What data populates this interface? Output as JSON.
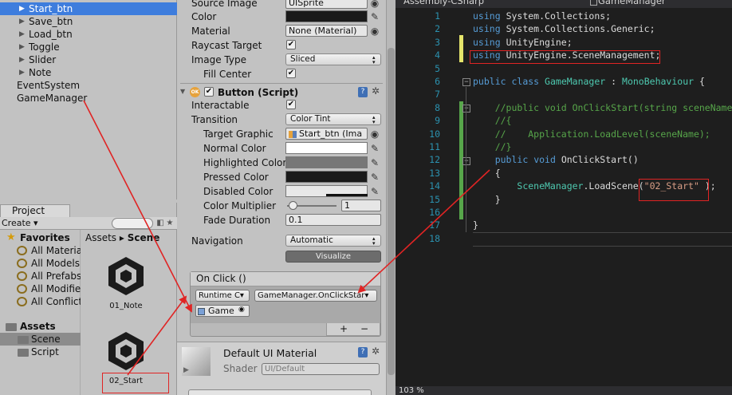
{
  "hierarchy": {
    "items": [
      {
        "label": "Start_btn",
        "depth": 1,
        "expand": "▶",
        "selected": true
      },
      {
        "label": "Save_btn",
        "depth": 1,
        "expand": "▶"
      },
      {
        "label": "Load_btn",
        "depth": 1,
        "expand": "▶"
      },
      {
        "label": "Toggle",
        "depth": 1,
        "expand": "▶"
      },
      {
        "label": "Slider",
        "depth": 1,
        "expand": "▶"
      },
      {
        "label": "Note",
        "depth": 1,
        "expand": "▶"
      },
      {
        "label": "EventSystem",
        "depth": 0
      },
      {
        "label": "GameManager",
        "depth": 0
      }
    ]
  },
  "project": {
    "tab_label": "Project",
    "create_label": "Create ▾",
    "favorites_label": "Favorites",
    "favorites": [
      "All Materia",
      "All Models",
      "All Prefabs",
      "All Modifie",
      "All Conflict"
    ],
    "assets_label": "Assets",
    "folders": [
      "Scene",
      "Script"
    ],
    "breadcrumb_root": "Assets",
    "breadcrumb_sep": "▸",
    "breadcrumb_current": "Scene",
    "scene_assets": [
      "01_Note",
      "02_Start"
    ]
  },
  "inspector": {
    "source_image_label": "Source Image",
    "source_image_value": "UISprite",
    "color_label": "Color",
    "material_label": "Material",
    "material_value": "None (Material)",
    "raycast_label": "Raycast Target",
    "image_type_label": "Image Type",
    "image_type_value": "Sliced",
    "fill_center_label": "Fill Center",
    "button_header": "Button (Script)",
    "interactable_label": "Interactable",
    "transition_label": "Transition",
    "transition_value": "Color Tint",
    "target_graphic_label": "Target Graphic",
    "target_graphic_value": "Start_btn (Ima",
    "normal_color_label": "Normal Color",
    "highlighted_color_label": "Highlighted Color",
    "pressed_color_label": "Pressed Color",
    "disabled_color_label": "Disabled Color",
    "color_multiplier_label": "Color Multiplier",
    "color_multiplier_value": "1",
    "fade_duration_label": "Fade Duration",
    "fade_duration_value": "0.1",
    "navigation_label": "Navigation",
    "navigation_value": "Automatic",
    "visualize_label": "Visualize",
    "onclick_label": "On Click ()",
    "runtime_value": "Runtime C▾",
    "function_value": "GameManager.OnClickStar▾",
    "object_value": "Game",
    "plus_label": "+",
    "minus_label": "−",
    "material_section_label": "Default UI Material",
    "shader_label": "Shader",
    "shader_value": "UI/Default",
    "colors": {
      "normal": "#ffffff",
      "highlighted": "#777777",
      "pressed": "#1a1a1a",
      "disabled": "#e8e8e8"
    }
  },
  "editor": {
    "tab_left": "Assembly-CSharp",
    "tab_right": "GameManager",
    "zoom": "103 %",
    "lines": [
      {
        "n": "1",
        "parts": [
          [
            "kw",
            "using"
          ],
          [
            "",
            "System.Collections;"
          ]
        ]
      },
      {
        "n": "2",
        "parts": [
          [
            "kw",
            "using"
          ],
          [
            "",
            "System.Collections.Generic;"
          ]
        ]
      },
      {
        "n": "3",
        "parts": [
          [
            "kw",
            "using"
          ],
          [
            "",
            "UnityEngine;"
          ]
        ]
      },
      {
        "n": "4",
        "parts": [
          [
            "kw",
            "using"
          ],
          [
            "",
            "UnityEngine.SceneManagement;"
          ]
        ]
      },
      {
        "n": "5",
        "parts": []
      },
      {
        "n": "6",
        "parts": [
          [
            "kw",
            "public"
          ],
          [
            "kw",
            "class"
          ],
          [
            "ty",
            "GameManager"
          ],
          [
            "",
            ":"
          ],
          [
            "ty",
            "MonoBehaviour"
          ],
          [
            "",
            "{"
          ]
        ]
      },
      {
        "n": "7",
        "parts": []
      },
      {
        "n": "8",
        "parts": [
          [
            "cm",
            "    //public void OnClickStart(string sceneName)"
          ]
        ]
      },
      {
        "n": "9",
        "parts": [
          [
            "cm",
            "    //{"
          ]
        ]
      },
      {
        "n": "10",
        "parts": [
          [
            "cm",
            "    //    Application.LoadLevel(sceneName);"
          ]
        ]
      },
      {
        "n": "11",
        "parts": [
          [
            "cm",
            "    //}"
          ]
        ]
      },
      {
        "n": "12",
        "parts": [
          [
            "",
            "    "
          ],
          [
            "kw",
            "public"
          ],
          [
            "kw",
            "void"
          ],
          [
            "",
            "OnClickStart()"
          ]
        ]
      },
      {
        "n": "13",
        "parts": [
          [
            "",
            "    {"
          ]
        ]
      },
      {
        "n": "14",
        "parts": [
          [
            "",
            "        "
          ],
          [
            "ty",
            "SceneManager"
          ],
          [
            "",
            ".LoadScene("
          ],
          [
            "st",
            "\"02_Start\""
          ],
          [
            "",
            ");"
          ]
        ]
      },
      {
        "n": "15",
        "parts": [
          [
            "",
            "    }"
          ]
        ]
      },
      {
        "n": "16",
        "parts": []
      },
      {
        "n": "17",
        "parts": [
          [
            "",
            "}"
          ]
        ]
      },
      {
        "n": "18",
        "parts": []
      }
    ]
  }
}
